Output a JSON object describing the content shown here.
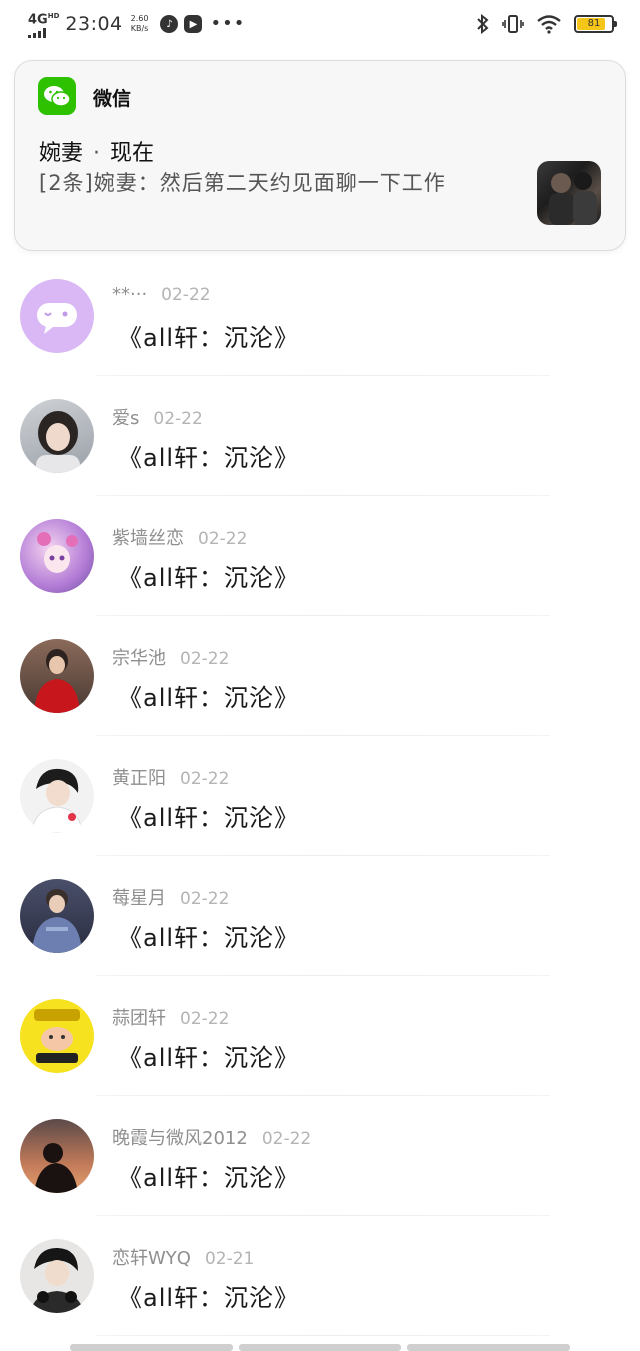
{
  "status_bar": {
    "network": "4G",
    "network_sup": "HD",
    "time": "23:04",
    "net_speed_value": "2.60",
    "net_speed_unit": "KB/s",
    "more": "•••",
    "battery_level": "81",
    "battery_fraction": 0.81
  },
  "notification": {
    "app_name": "微信",
    "sender": "婉妻",
    "separator": "·",
    "time": "现在",
    "body": "[2条]婉妻：然后第二天约见面聊一下工作"
  },
  "messages": [
    {
      "name": "**···",
      "date": "02-22",
      "text": "《all轩：沉沦》"
    },
    {
      "name": "爱s",
      "date": "02-22",
      "text": "《all轩：沉沦》"
    },
    {
      "name": "紫墙丝恋",
      "date": "02-22",
      "text": "《all轩：沉沦》"
    },
    {
      "name": "宗华池",
      "date": "02-22",
      "text": "《all轩：沉沦》"
    },
    {
      "name": "黄正阳",
      "date": "02-22",
      "text": "《all轩：沉沦》"
    },
    {
      "name": "莓星月",
      "date": "02-22",
      "text": "《all轩：沉沦》"
    },
    {
      "name": "蒜团轩",
      "date": "02-22",
      "text": "《all轩：沉沦》"
    },
    {
      "name": "晚霞与微风2012",
      "date": "02-22",
      "text": "《all轩：沉沦》"
    },
    {
      "name": "恋轩WYQ",
      "date": "02-21",
      "text": "《all轩：沉沦》"
    }
  ],
  "avatar_icons": [
    "purple-chat-bubble-avatar",
    "girl-portrait-avatar",
    "anime-girl-avatar",
    "red-dress-portrait-avatar",
    "boy-portrait-avatar",
    "boy-in-denim-avatar",
    "yellow-cartoon-avatar",
    "sunset-silhouette-avatar",
    "boy-with-headphones-avatar"
  ],
  "colors": {
    "wechat_green": "#2dc100",
    "battery": "#f5c518",
    "avatar_lilac": "#d9b8f5"
  }
}
